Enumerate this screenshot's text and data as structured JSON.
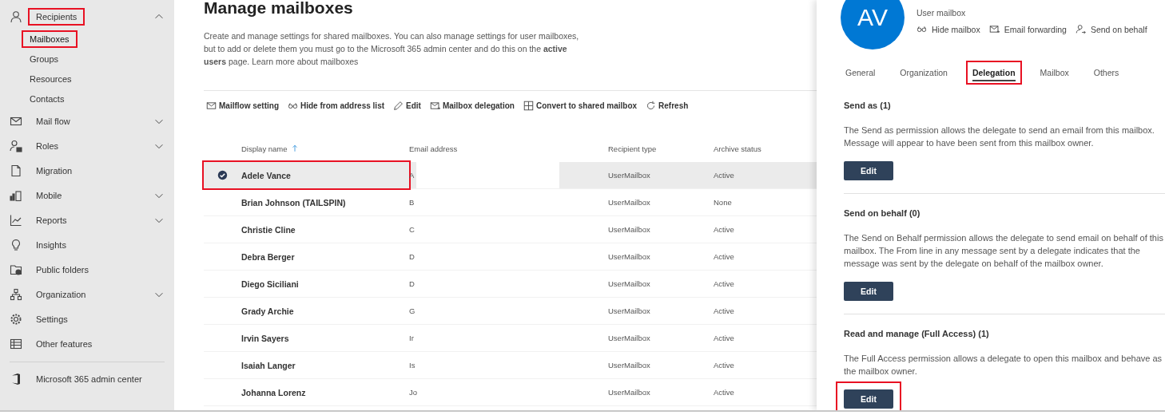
{
  "sidebar": {
    "items": [
      {
        "label": "Recipients",
        "kind": "group",
        "expanded": true,
        "highlighted": true,
        "children": [
          {
            "label": "Mailboxes",
            "selected": true,
            "highlighted": true
          },
          {
            "label": "Groups",
            "selected": false,
            "highlighted": false
          },
          {
            "label": "Resources",
            "selected": false,
            "highlighted": false
          },
          {
            "label": "Contacts",
            "selected": false,
            "highlighted": false
          }
        ]
      },
      {
        "label": "Mail flow",
        "kind": "group",
        "expanded": false,
        "highlighted": false
      },
      {
        "label": "Roles",
        "kind": "group",
        "expanded": false,
        "highlighted": false
      },
      {
        "label": "Migration",
        "kind": "link",
        "highlighted": false
      },
      {
        "label": "Mobile",
        "kind": "group",
        "expanded": false,
        "highlighted": false
      },
      {
        "label": "Reports",
        "kind": "group",
        "expanded": false,
        "highlighted": false
      },
      {
        "label": "Insights",
        "kind": "link",
        "highlighted": false
      },
      {
        "label": "Public folders",
        "kind": "link",
        "highlighted": false
      },
      {
        "label": "Organization",
        "kind": "group",
        "expanded": false,
        "highlighted": false
      },
      {
        "label": "Settings",
        "kind": "link",
        "highlighted": false
      },
      {
        "label": "Other features",
        "kind": "link",
        "highlighted": false
      }
    ],
    "footer": "Microsoft 365 admin center"
  },
  "main": {
    "title": "Manage mailboxes",
    "description": "Create and manage settings for shared mailboxes. You can also manage settings for user mailboxes, but to add or delete them you must go to the Microsoft 365 admin center and do this on the **active users** page. Learn more about mailboxes",
    "toolbar": [
      "Mailflow setting",
      "Hide from address list",
      "Edit",
      "Mailbox delegation",
      "Convert to shared mailbox",
      "Refresh"
    ],
    "table": {
      "columns": [
        {
          "label": "Display name",
          "sorted": true
        },
        {
          "label": "Email address",
          "sorted": false
        },
        {
          "label": "Recipient type",
          "sorted": false
        },
        {
          "label": "Archive status",
          "sorted": false
        }
      ],
      "rows": [
        {
          "selected": true,
          "highlighted": true,
          "cells": [
            "Adele Vance",
            "A",
            "UserMailbox",
            "Active"
          ]
        },
        {
          "selected": false,
          "highlighted": false,
          "cells": [
            "Brian Johnson (TAILSPIN)",
            "B",
            "UserMailbox",
            "None"
          ]
        },
        {
          "selected": false,
          "highlighted": false,
          "cells": [
            "Christie Cline",
            "C",
            "UserMailbox",
            "Active"
          ]
        },
        {
          "selected": false,
          "highlighted": false,
          "cells": [
            "Debra Berger",
            "D",
            "UserMailbox",
            "Active"
          ]
        },
        {
          "selected": false,
          "highlighted": false,
          "cells": [
            "Diego Siciliani",
            "D",
            "UserMailbox",
            "Active"
          ]
        },
        {
          "selected": false,
          "highlighted": false,
          "cells": [
            "Grady Archie",
            "G",
            "UserMailbox",
            "Active"
          ]
        },
        {
          "selected": false,
          "highlighted": false,
          "cells": [
            "Irvin Sayers",
            "Ir",
            "UserMailbox",
            "Active"
          ]
        },
        {
          "selected": false,
          "highlighted": false,
          "cells": [
            "Isaiah Langer",
            "Is",
            "UserMailbox",
            "Active"
          ]
        },
        {
          "selected": false,
          "highlighted": false,
          "cells": [
            "Johanna Lorenz",
            "Jo",
            "UserMailbox",
            "Active"
          ]
        }
      ]
    }
  },
  "panel": {
    "initials": "AV",
    "subtitle": "User mailbox",
    "actions": [
      "Hide mailbox",
      "Email forwarding",
      "Send on behalf"
    ],
    "tabs": [
      {
        "label": "General",
        "selected": false,
        "highlighted": false
      },
      {
        "label": "Organization",
        "selected": false,
        "highlighted": false
      },
      {
        "label": "Delegation",
        "selected": true,
        "highlighted": true
      },
      {
        "label": "Mailbox",
        "selected": false,
        "highlighted": false
      },
      {
        "label": "Others",
        "selected": false,
        "highlighted": false
      }
    ],
    "sections": [
      {
        "title": "Send as (1)",
        "text": "The Send as permission allows the delegate to send an email from this mailbox. Message will appear to have been sent from this mailbox owner.",
        "button": "Edit",
        "highlighted": false
      },
      {
        "title": "Send on behalf (0)",
        "text": "The Send on Behalf permission allows the delegate to send email on behalf of this mailbox. The From line in any message sent by a delegate indicates that the message was sent by the delegate on behalf of the mailbox owner.",
        "button": "Edit",
        "highlighted": false
      },
      {
        "title": "Read and manage (Full Access) (1)",
        "text": "The Full Access permission allows a delegate to open this mailbox and behave as the mailbox owner.",
        "button": "Edit",
        "highlighted": true
      }
    ]
  }
}
